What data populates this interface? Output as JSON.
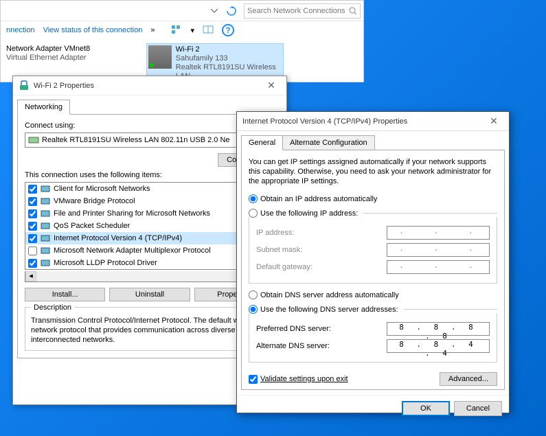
{
  "explorer": {
    "search_placeholder": "Search Network Connections",
    "cmd_connection": "nnection",
    "cmd_status": "View status of this connection",
    "adapter1_name": "Network Adapter VMnet8",
    "adapter1_sub": "Virtual Ethernet Adapter",
    "adapter2_name": "Wi-Fi 2",
    "adapter2_ssid": "Sahufamily   133",
    "adapter2_dev": "Realtek RTL8191SU Wireless LAN ..."
  },
  "props1": {
    "title": "Wi-Fi 2 Properties",
    "tab": "Networking",
    "connect_using": "Connect using:",
    "adapter": "Realtek RTL8191SU Wireless LAN 802.11n USB 2.0 Ne",
    "configure": "Configure...",
    "items_label": "This connection uses the following items:",
    "items": [
      {
        "checked": true,
        "label": "Client for Microsoft Networks"
      },
      {
        "checked": true,
        "label": "VMware Bridge Protocol"
      },
      {
        "checked": true,
        "label": "File and Printer Sharing for Microsoft Networks"
      },
      {
        "checked": true,
        "label": "QoS Packet Scheduler"
      },
      {
        "checked": true,
        "label": "Internet Protocol Version 4 (TCP/IPv4)",
        "selected": true
      },
      {
        "checked": false,
        "label": "Microsoft Network Adapter Multiplexor Protocol"
      },
      {
        "checked": true,
        "label": "Microsoft LLDP Protocol Driver"
      }
    ],
    "install": "Install...",
    "uninstall": "Uninstall",
    "properties": "Properties",
    "desc_title": "Description",
    "desc": "Transmission Control Protocol/Internet Protocol. The default wide area network protocol that provides communication across diverse interconnected networks."
  },
  "props2": {
    "title": "Internet Protocol Version 4 (TCP/IPv4) Properties",
    "tab_general": "General",
    "tab_alt": "Alternate Configuration",
    "intro": "You can get IP settings assigned automatically if your network supports this capability. Otherwise, you need to ask your network administrator for the appropriate IP settings.",
    "radio_ip_auto": "Obtain an IP address automatically",
    "radio_ip_manual": "Use the following IP address:",
    "ip_address": "IP address:",
    "subnet": "Subnet mask:",
    "gateway": "Default gateway:",
    "radio_dns_auto": "Obtain DNS server address automatically",
    "radio_dns_manual": "Use the following DNS server addresses:",
    "dns_pref": "Preferred DNS server:",
    "dns_pref_val": "8 . 8 . 8 . 8",
    "dns_alt": "Alternate DNS server:",
    "dns_alt_val": "8 . 8 . 4 . 4",
    "validate": "Validate settings upon exit",
    "advanced": "Advanced...",
    "ok": "OK",
    "cancel": "Cancel"
  }
}
